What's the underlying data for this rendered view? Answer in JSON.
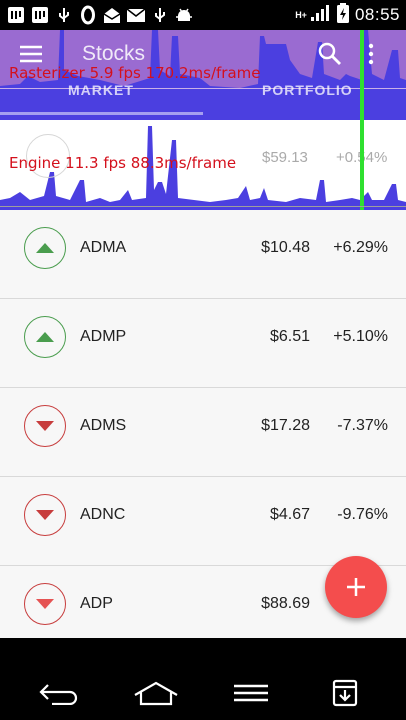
{
  "status_bar": {
    "time": "08:55",
    "network_type": "H+",
    "icons": [
      "notification-icon",
      "notification-icon",
      "usb-icon",
      "zero-icon",
      "mail-open-icon",
      "mail-icon",
      "usb-icon",
      "android-debug-icon"
    ],
    "right_icons": [
      "signal-icon",
      "battery-charging-icon"
    ]
  },
  "toolbar": {
    "title": "Stocks",
    "menu_icon": "menu-icon",
    "search_icon": "search-icon",
    "more_icon": "more-vert-icon"
  },
  "tabs": [
    {
      "label": "MARKET",
      "selected": true
    },
    {
      "label": "PORTFOLIO",
      "selected": false
    }
  ],
  "performance_overlay": {
    "rasterizer": "Rasterizer 5.9 fps  170.2ms/frame",
    "engine": "Engine 11.3 fps  88.3ms/frame"
  },
  "ghost_row": {
    "price": "$59.13",
    "change": "+0.54%"
  },
  "stocks": [
    {
      "symbol": "ADMA",
      "price": "$10.48",
      "change": "+6.29%",
      "trend": "up"
    },
    {
      "symbol": "ADMP",
      "price": "$6.51",
      "change": "+5.10%",
      "trend": "up"
    },
    {
      "symbol": "ADMS",
      "price": "$17.28",
      "change": "-7.37%",
      "trend": "down"
    },
    {
      "symbol": "ADNC",
      "price": "$4.67",
      "change": "-9.76%",
      "trend": "down"
    },
    {
      "symbol": "ADP",
      "price": "$88.69",
      "change": "",
      "trend": "down"
    }
  ],
  "fab": {
    "icon": "add-icon"
  },
  "colors": {
    "up": "#4a9d4e",
    "down": "#c73d3d",
    "fab": "#f44d4d",
    "app_bar": "#9a6bd1",
    "graph_bars": "#4b3fe0",
    "perf_text": "#d4101c",
    "frame_marker": "#2fe02f"
  },
  "nav_bar": [
    "back-icon",
    "home-icon",
    "recent-apps-icon",
    "download-icon"
  ]
}
